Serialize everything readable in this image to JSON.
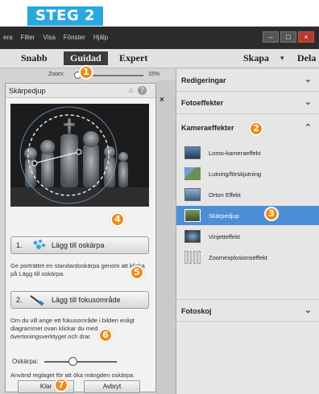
{
  "step_badge": "STEG 2",
  "menubar": {
    "items": [
      "era",
      "Filter",
      "Visa",
      "Fönster",
      "Hjälp"
    ]
  },
  "window_controls": {
    "minimize": "–",
    "maximize": "□",
    "close": "×"
  },
  "modes": {
    "quick": "Snabb",
    "guided": "Guidad",
    "expert": "Expert",
    "create": "Skapa",
    "create_arrow": "▾",
    "share": "Dela"
  },
  "zoom": {
    "label": "Zoom:",
    "value": "15%",
    "level_percent": 15
  },
  "panel": {
    "title": "Skärpedjup",
    "step1_num": "1.",
    "step1_label": "Lägg till oskärpa",
    "step1_help": "Ge porträttet en standardoskärpa genom att klicka på Lägg till oskärpa.",
    "step2_num": "2.",
    "step2_label": "Lägg till fokusområde",
    "step2_help": "Om du vill ange ett fokusområde i bilden enligt diagrammet ovan klickar du med övertoningsverktyget och drar.",
    "blur_label": "Oskärpa:",
    "blur_level_percent": 33,
    "blur_help": "Använd reglaget för att öka mängden oskärpa.",
    "done": "Klar",
    "cancel": "Avbryt"
  },
  "right_panel": {
    "categories": [
      {
        "label": "Redigeringar",
        "chevron": "⌄"
      },
      {
        "label": "Fotoeffekter",
        "chevron": "⌄"
      },
      {
        "label": "Kameraeffekter",
        "chevron": "⌃"
      },
      {
        "label": "Fotoskoj",
        "chevron": "⌄"
      }
    ],
    "effects": [
      {
        "label": "Lomo-kameraeffekt"
      },
      {
        "label": "Lutning/förskjutning"
      },
      {
        "label": "Orton Effekt"
      },
      {
        "label": "Skärpedjup"
      },
      {
        "label": "Vinjetteffekt"
      },
      {
        "label": "Zoomexplosionseffekt"
      }
    ]
  },
  "panel_close": "×",
  "callouts": [
    "1",
    "2",
    "3",
    "4",
    "5",
    "6",
    "7"
  ],
  "colors": {
    "accent_orange": "#ee8b1b",
    "badge_blue": "#29a8e0",
    "selection_blue": "#4c8fd6"
  },
  "icons": {
    "home": "home-icon",
    "help": "help-icon",
    "blur": "blur-droplets-icon",
    "focus": "gradient-tool-icon",
    "chevron": "chevron-icon"
  }
}
